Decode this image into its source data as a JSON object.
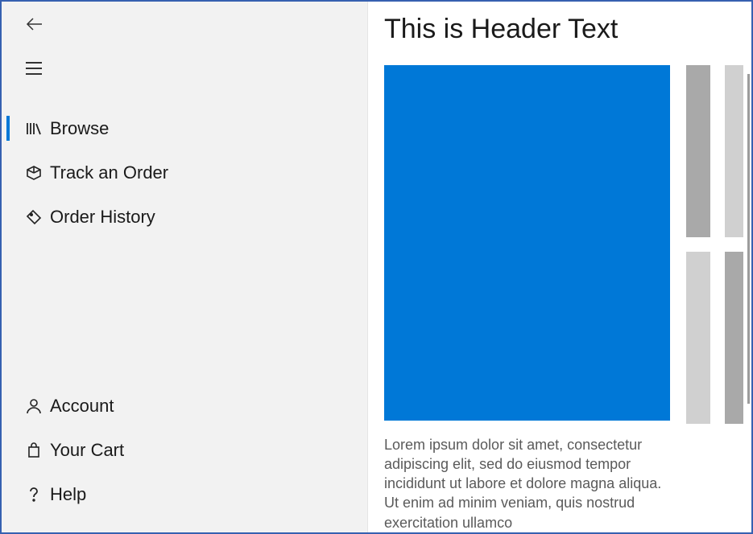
{
  "header": {
    "title": "This is Header Text"
  },
  "nav": {
    "top": [
      {
        "label": "Browse",
        "icon": "library-icon",
        "selected": true
      },
      {
        "label": "Track an Order",
        "icon": "package-icon",
        "selected": false
      },
      {
        "label": "Order History",
        "icon": "tag-icon",
        "selected": false
      }
    ],
    "bottom": [
      {
        "label": "Account",
        "icon": "person-icon"
      },
      {
        "label": "Your Cart",
        "icon": "cart-icon"
      },
      {
        "label": "Help",
        "icon": "help-icon"
      }
    ]
  },
  "content": {
    "body_text": "Lorem ipsum dolor sit amet, consectetur adipiscing elit, sed do eiusmod tempor incididunt ut labore et dolore magna aliqua. Ut enim ad minim veniam, quis nostrud exercitation ullamco",
    "hero_color": "#0078d7"
  }
}
